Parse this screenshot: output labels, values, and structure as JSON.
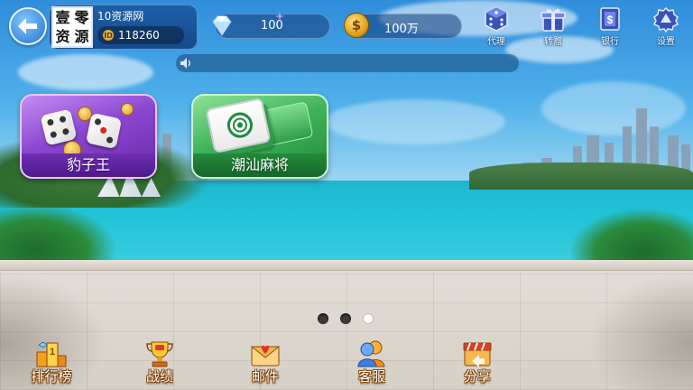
{
  "player": {
    "avatar_chars": [
      "壹",
      "零",
      "资",
      "源"
    ],
    "name": "10资源网",
    "id_icon": "ID",
    "id_value": "118260"
  },
  "resources": {
    "diamond_icon": "diamond-icon",
    "diamond_value": "100",
    "gold_icon_glyph": "$",
    "gold_value": "100万"
  },
  "top_menu": [
    {
      "icon": "dice-icon",
      "label": "代理"
    },
    {
      "icon": "gift-icon",
      "label": "转赠"
    },
    {
      "icon": "bank-icon",
      "label": "银行"
    },
    {
      "icon": "gear-icon",
      "label": "设置"
    }
  ],
  "games": [
    {
      "icon": "dice-game-icon",
      "title": "豹子王"
    },
    {
      "icon": "mahjong-tile-icon",
      "title": "潮汕麻将"
    }
  ],
  "pager": {
    "count": 3,
    "active_index": 2
  },
  "bottom_nav": [
    {
      "icon": "ranking-icon",
      "label": "排行榜"
    },
    {
      "icon": "trophy-icon",
      "label": "战绩"
    },
    {
      "icon": "mail-icon",
      "label": "邮件"
    },
    {
      "icon": "customer-service-icon",
      "label": "客服"
    },
    {
      "icon": "share-icon",
      "label": "分享"
    }
  ],
  "colors": {
    "sky": "#2f8ddb",
    "sea": "#22c3d8",
    "card_purple": "#8a46d0",
    "card_green": "#3fb35a",
    "gold": "#e0a21c"
  }
}
